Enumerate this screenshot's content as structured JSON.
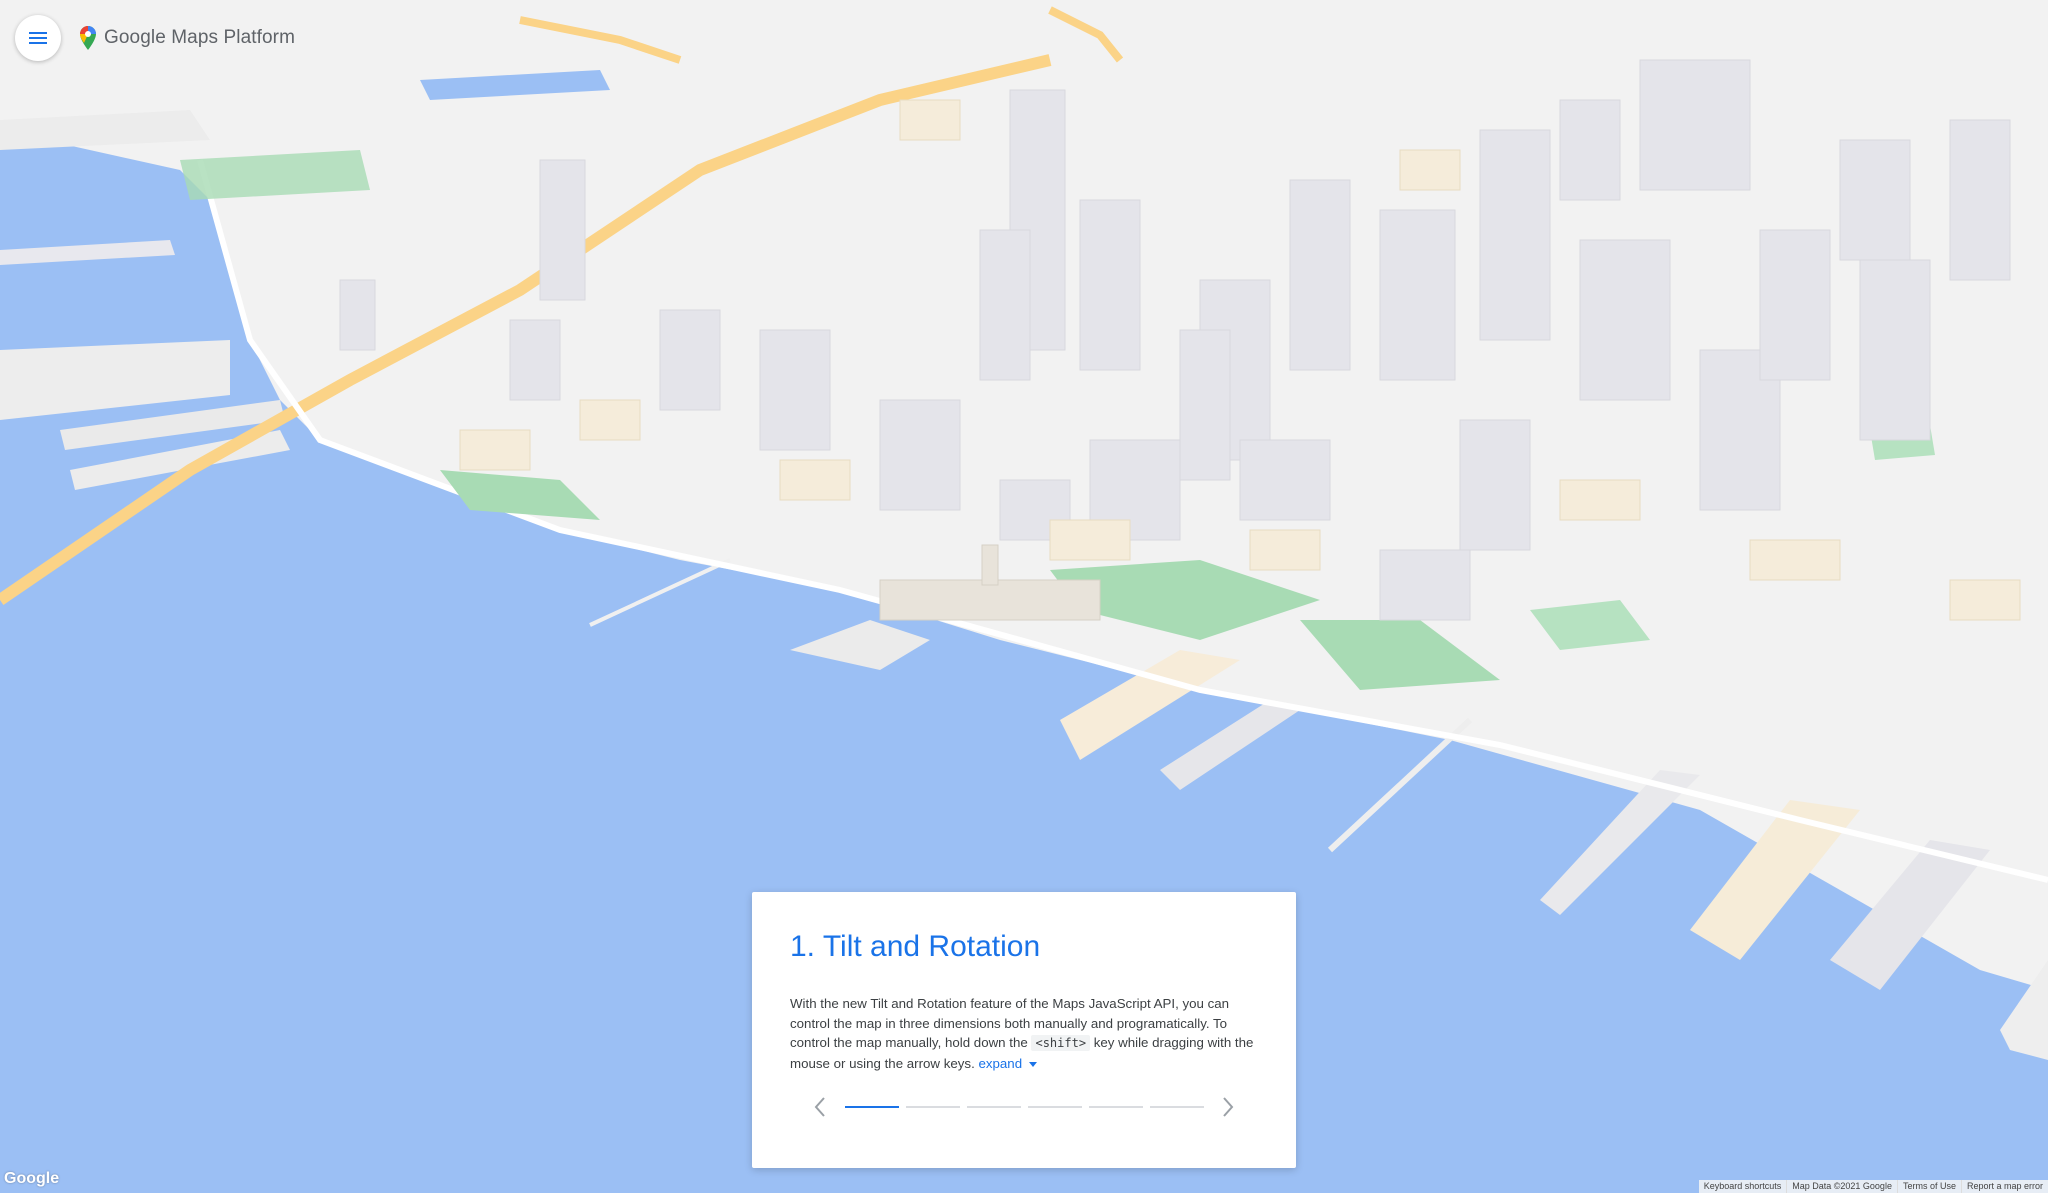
{
  "app": {
    "brand": "Google Maps Platform",
    "icons": {
      "menu": "hamburger-menu-icon",
      "logo": "maps-pin-icon"
    }
  },
  "colors": {
    "water": "#9bbff4",
    "land": "#f2f2f2",
    "park": "#a8dbb4",
    "highway": "#fbd387",
    "accent": "#1a73e8"
  },
  "card": {
    "title": "1. Tilt and Rotation",
    "body_part1": "With the new Tilt and Rotation feature of the Maps JavaScript API, you can control the map in three dimensions both manually and programatically. To control the map manually, hold down the",
    "body_code": "<shift>",
    "body_part2": "key while dragging with the mouse or using the arrow keys.",
    "expand_label": "expand",
    "pager": {
      "total": 6,
      "current": 1
    },
    "icons": {
      "prev": "chevron-left-icon",
      "next": "chevron-right-icon",
      "expand": "caret-down-icon"
    }
  },
  "map": {
    "logo": "Google",
    "footer": {
      "keyboard_shortcuts": "Keyboard shortcuts",
      "map_data": "Map Data ©2021 Google",
      "terms": "Terms of Use",
      "report": "Report a map error"
    }
  }
}
